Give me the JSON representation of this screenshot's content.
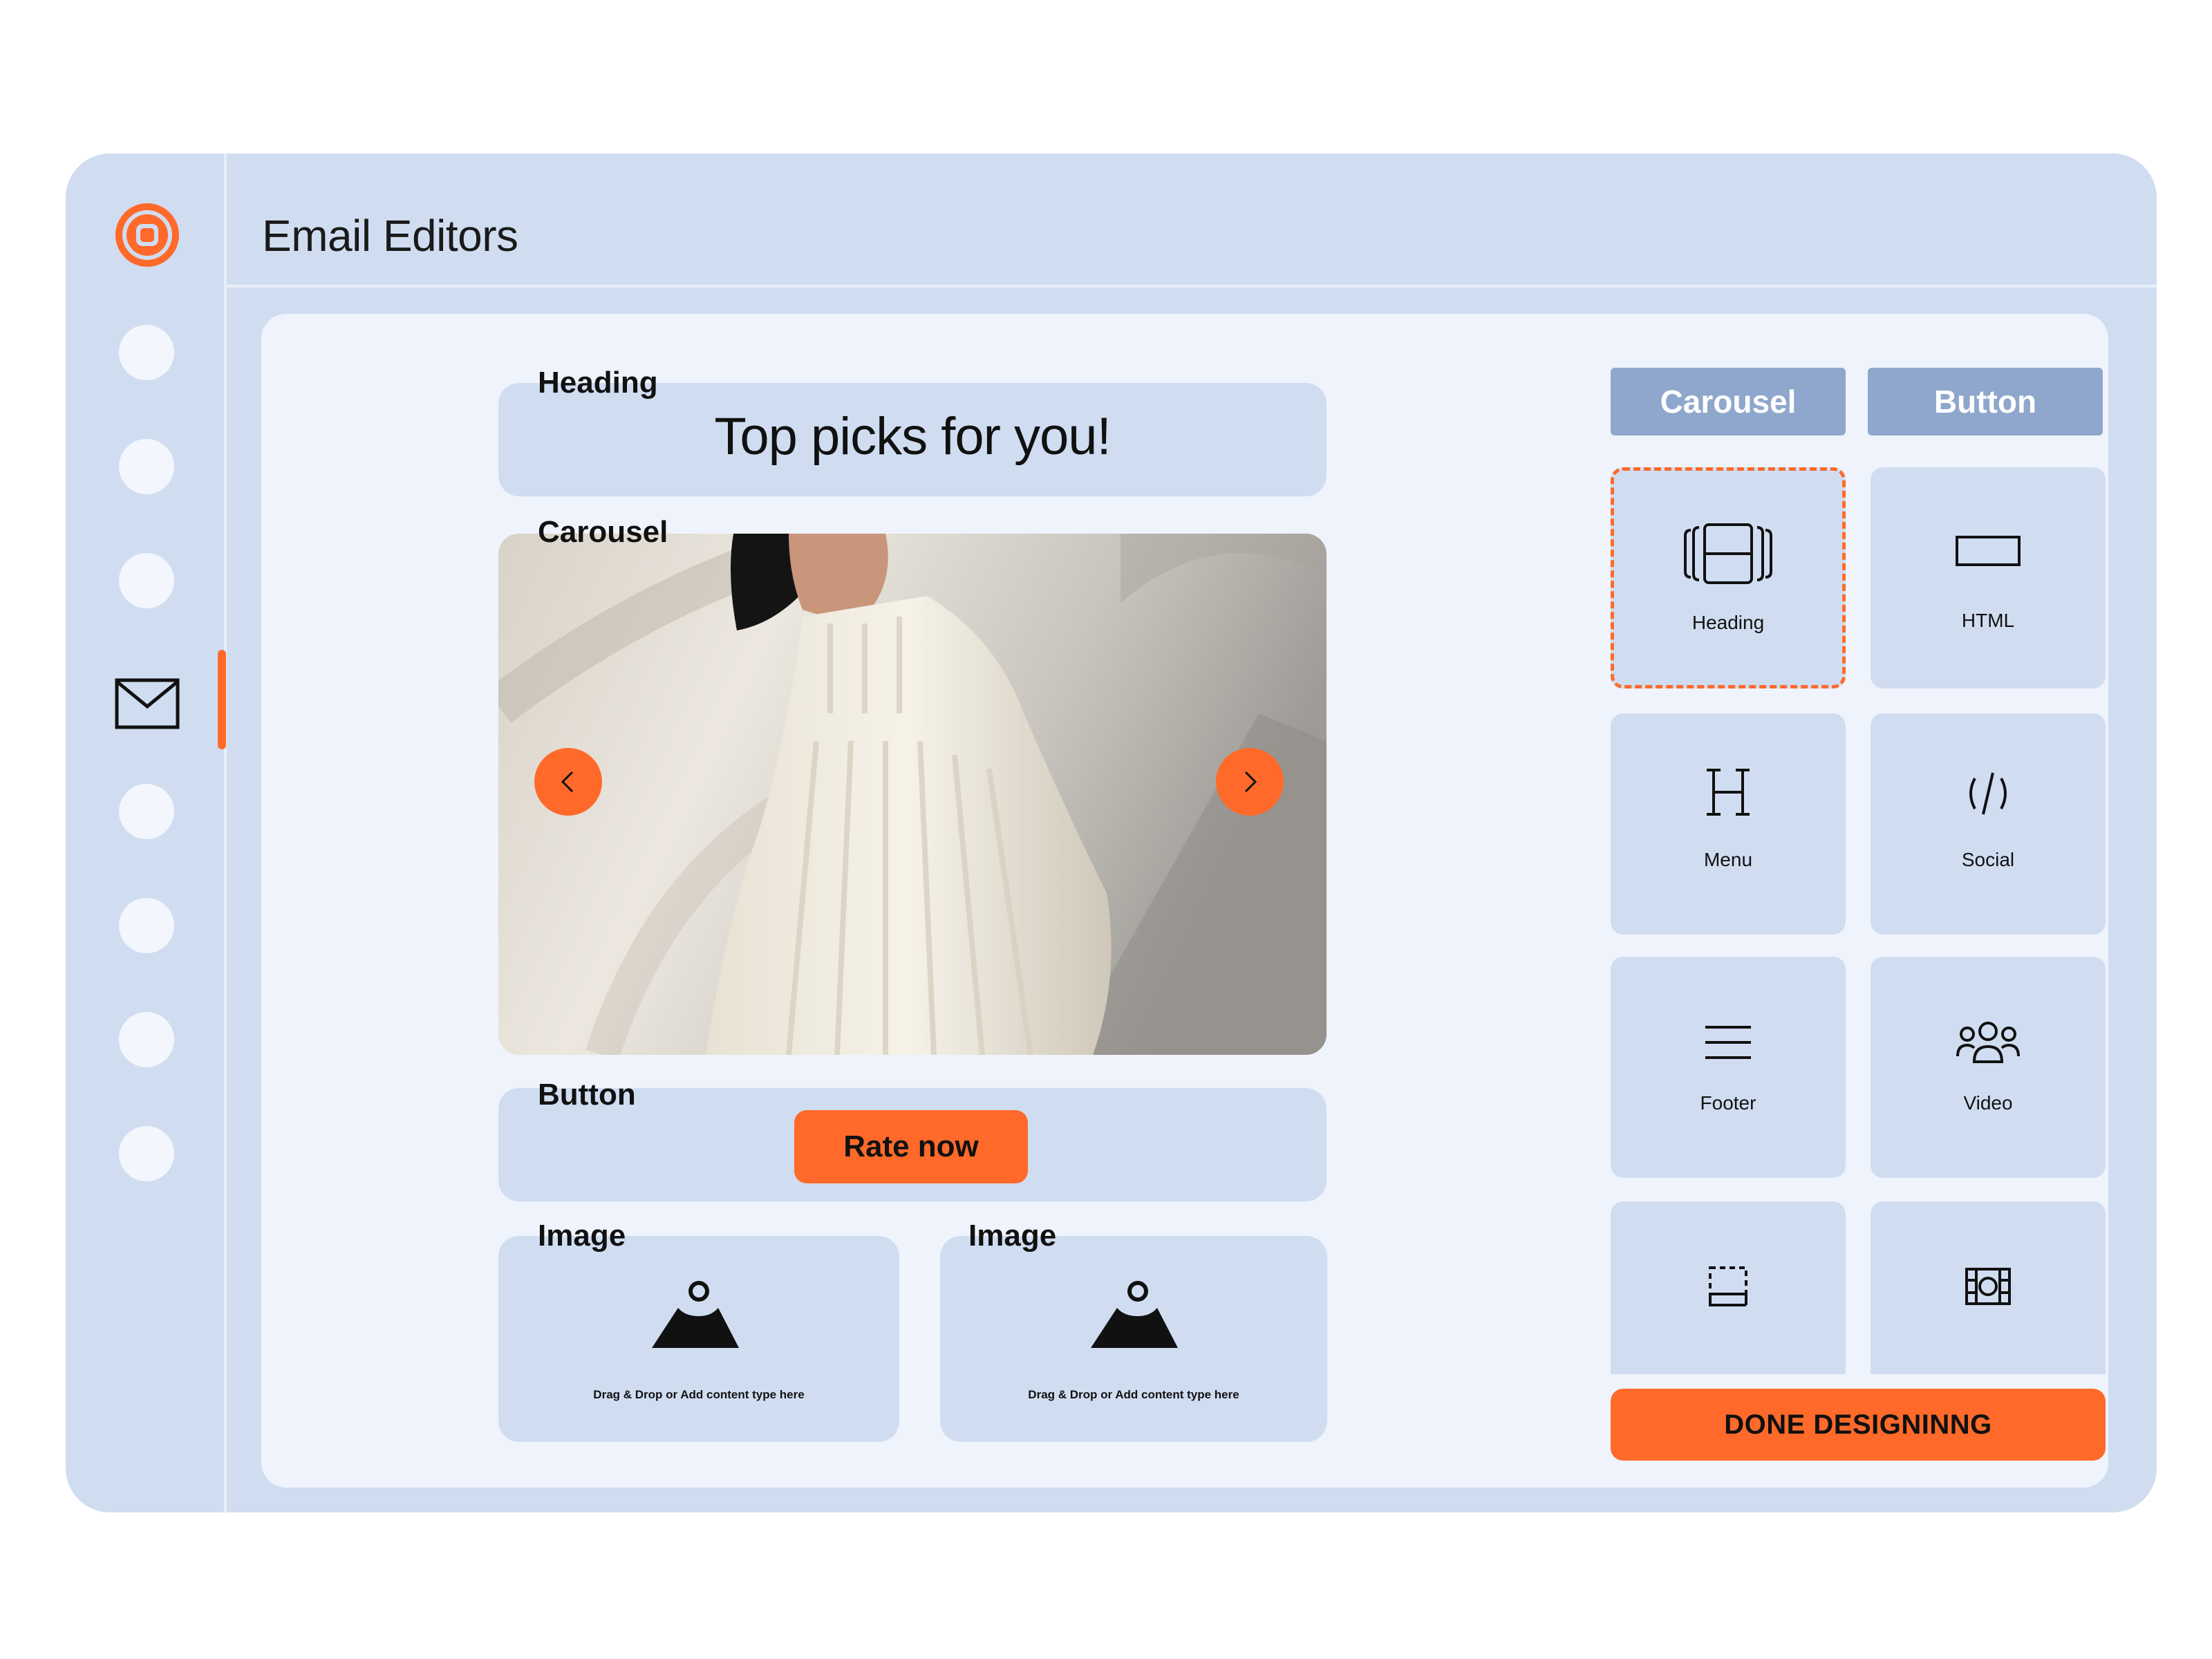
{
  "app": {
    "title": "Email Editors"
  },
  "sidebar": {
    "items": [
      {
        "name": "nav-item-1"
      },
      {
        "name": "nav-item-2"
      },
      {
        "name": "nav-item-3"
      },
      {
        "name": "nav-item-email",
        "icon": "mail-icon",
        "active": true
      },
      {
        "name": "nav-item-5"
      },
      {
        "name": "nav-item-6"
      },
      {
        "name": "nav-item-7"
      },
      {
        "name": "nav-item-8"
      }
    ]
  },
  "editor": {
    "heading_block": {
      "label": "Heading",
      "text": "Top picks for you!"
    },
    "carousel_block": {
      "label": "Carousel"
    },
    "button_block": {
      "label": "Button",
      "button_text": "Rate now"
    },
    "image_blocks": [
      {
        "label": "Image",
        "placeholder": "Drag & Drop or Add content type here"
      },
      {
        "label": "Image",
        "placeholder": "Drag & Drop or Add content type here"
      }
    ]
  },
  "panel": {
    "tabs": [
      {
        "label": "Carousel"
      },
      {
        "label": "Button"
      }
    ],
    "tiles": [
      {
        "label": "Heading",
        "icon": "carousel-icon",
        "selected": true
      },
      {
        "label": "HTML",
        "icon": "button-rect-icon"
      },
      {
        "label": "Menu",
        "icon": "heading-h-icon"
      },
      {
        "label": "Social",
        "icon": "code-icon"
      },
      {
        "label": "Footer",
        "icon": "menu-lines-icon"
      },
      {
        "label": "Video",
        "icon": "people-icon"
      },
      {
        "label": "",
        "icon": "footer-icon"
      },
      {
        "label": "",
        "icon": "video-film-icon"
      }
    ],
    "done_label": "DONE DESIGNINNG"
  },
  "colors": {
    "accent": "#ff6a2a",
    "panel_bg": "#d0ddf1",
    "canvas_bg": "#eff3fc",
    "tab_bg": "#8fa7cc"
  }
}
